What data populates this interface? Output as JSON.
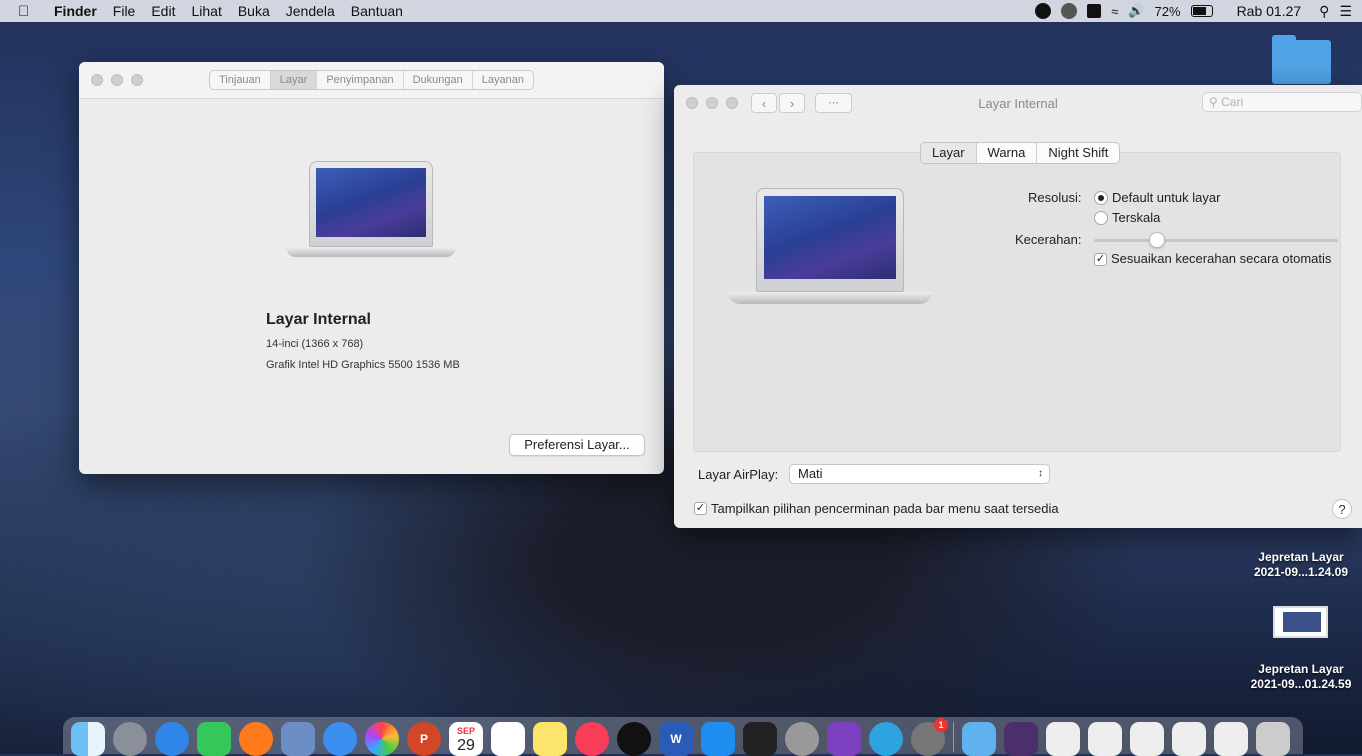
{
  "menubar": {
    "app_name": "Finder",
    "items": [
      "File",
      "Edit",
      "Lihat",
      "Buka",
      "Jendela",
      "Bantuan"
    ],
    "battery": "72%",
    "clock": "Rab 01.27"
  },
  "about_window": {
    "tabs": [
      "Tinjauan",
      "Layar",
      "Penyimpanan",
      "Dukungan",
      "Layanan"
    ],
    "active_tab": "Layar",
    "display_name": "Layar Internal",
    "size_line": "14-inci (1366 x 768)",
    "graphics_line": "Grafik Intel HD Graphics 5500 1536 MB",
    "button_label": "Preferensi Layar..."
  },
  "prefs_window": {
    "title": "Layar Internal",
    "search_placeholder": "Cari",
    "tabs": [
      "Layar",
      "Warna",
      "Night Shift"
    ],
    "active_tab": "Layar",
    "resolution_label": "Resolusi:",
    "resolution_options": [
      "Default untuk layar",
      "Terskala"
    ],
    "resolution_selected": "Default untuk layar",
    "brightness_label": "Kecerahan:",
    "brightness_level": 0.26,
    "auto_brightness_label": "Sesuaikan kecerahan secara otomatis",
    "auto_brightness_checked": true,
    "airplay_label": "Layar AirPlay:",
    "airplay_value": "Mati",
    "mirroring_label": "Tampilkan pilihan pencerminan pada bar menu saat tersedia",
    "mirroring_checked": true,
    "help_label": "?"
  },
  "desktop": {
    "items": [
      {
        "line1": "Jepretan Layar",
        "line2": "2021-09...1.24.09"
      },
      {
        "line1": "Jepretan Layar",
        "line2": "2021-09...01.24.59"
      }
    ]
  },
  "dock": {
    "calendar_month": "SEP",
    "calendar_day": "29",
    "prefs_badge": "1"
  }
}
